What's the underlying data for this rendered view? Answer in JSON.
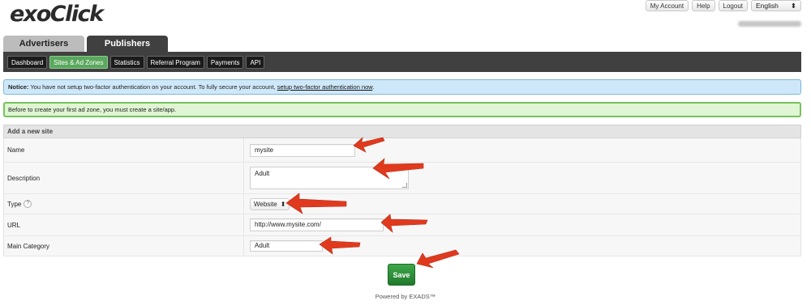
{
  "brand": {
    "logo_text": "exoClick"
  },
  "top_links": {
    "my_account": "My Account",
    "help": "Help",
    "logout": "Logout",
    "language": "English"
  },
  "main_tabs": [
    {
      "label": "Advertisers"
    },
    {
      "label": "Publishers"
    }
  ],
  "sub_nav": [
    {
      "label": "Dashboard"
    },
    {
      "label": "Sites & Ad Zones"
    },
    {
      "label": "Statistics"
    },
    {
      "label": "Referral Program"
    },
    {
      "label": "Payments"
    },
    {
      "label": "API"
    }
  ],
  "notice": {
    "prefix": "Notice:",
    "text": " You have not setup two-factor authentication on your account. To fully secure your account, ",
    "link": "setup two-factor authentication now",
    "suffix": "."
  },
  "info_message": "Before to create your first ad zone, you must create a site/app.",
  "form": {
    "heading": "Add a new site",
    "name_label": "Name",
    "name_value": "mysite",
    "description_label": "Description",
    "description_value": "Adult",
    "type_label": "Type",
    "type_help": "?",
    "type_value": "Website",
    "url_label": "URL",
    "url_value": "http://www.mysite.com/",
    "category_label": "Main Category",
    "category_value": "Adult"
  },
  "save_label": "Save",
  "footer": "Powered by EXADS™",
  "colors": {
    "active_tab": "#404040",
    "active_subnav": "#5aa85e",
    "save": "#2a8b35",
    "arrow": "#e03a1e"
  }
}
